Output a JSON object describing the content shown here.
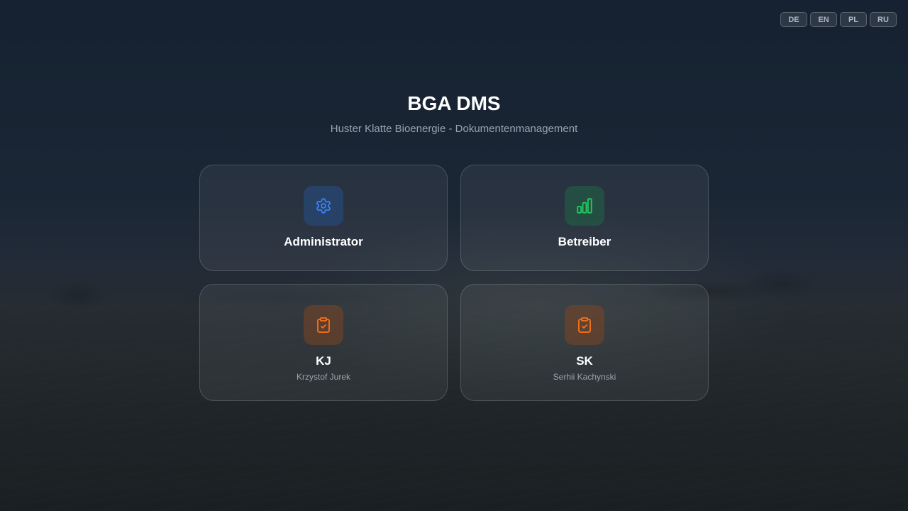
{
  "languages": [
    "DE",
    "EN",
    "PL",
    "RU"
  ],
  "header": {
    "title": "BGA DMS",
    "subtitle": "Huster Klatte Bioenergie - Dokumentenmanagement"
  },
  "users": [
    {
      "name": "Administrator",
      "icon": "gear-icon",
      "color": "#3b82f6"
    },
    {
      "name": "Betreiber",
      "icon": "bar-chart-icon",
      "color": "#22c55e"
    },
    {
      "name": "KJ",
      "full_name": "Krzystof Jurek",
      "icon": "clipboard-check-icon",
      "color": "#f97316"
    },
    {
      "name": "SK",
      "full_name": "Serhii Kachynski",
      "icon": "clipboard-check-icon",
      "color": "#f97316"
    }
  ]
}
